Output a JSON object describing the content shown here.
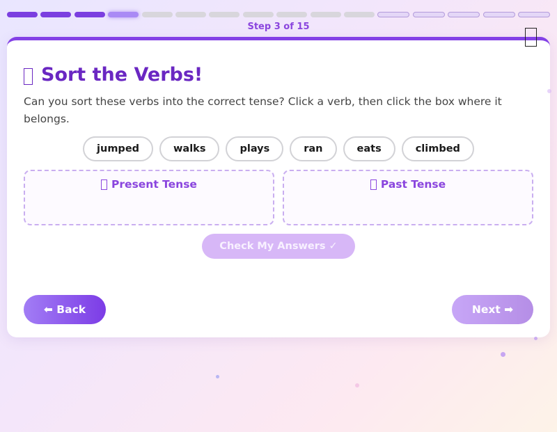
{
  "progress": {
    "step_text": "Step 3 of 15",
    "current_step": 3,
    "total_steps": 15,
    "segments": [
      "done",
      "done",
      "done",
      "current",
      "pending",
      "pending",
      "pending",
      "pending",
      "pending",
      "pending",
      "pending",
      "outline",
      "outline",
      "outline",
      "outline",
      "outline"
    ]
  },
  "activity": {
    "title": "Sort the Verbs!",
    "instructions": "Can you sort these verbs into the correct tense? Click a verb, then click the box where it belongs.",
    "verbs": [
      "jumped",
      "walks",
      "plays",
      "ran",
      "eats",
      "climbed"
    ],
    "zones": {
      "present": "Present Tense",
      "past": "Past Tense"
    },
    "check_label": "Check My Answers ✓"
  },
  "nav": {
    "back_label": "⬅ Back",
    "next_label": "Next ➡"
  },
  "colors": {
    "accent": "#7b3fe0",
    "title": "#6a27c2",
    "zone_border": "#c9aef0",
    "check_button": "#d7b7f7",
    "next_button": "#b58ee6"
  }
}
